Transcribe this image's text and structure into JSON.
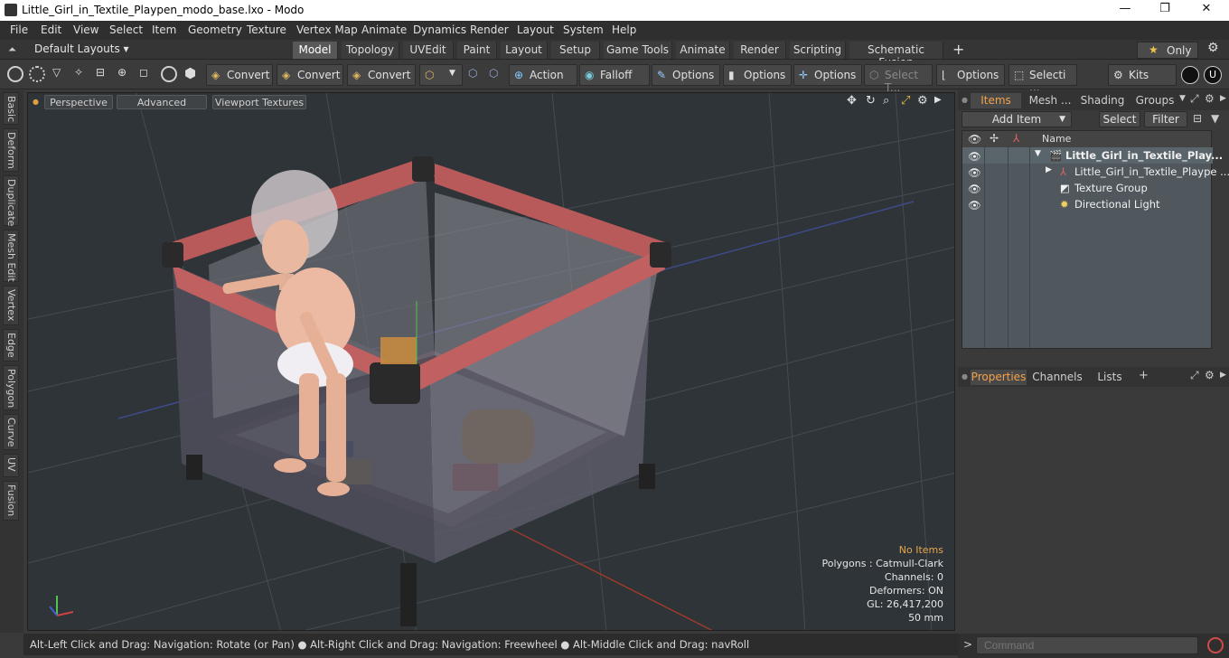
{
  "window": {
    "title": "Little_Girl_in_Textile_Playpen_modo_base.lxo - Modo",
    "minimize": "—",
    "maximize": "❐",
    "close": "✕"
  },
  "menu": [
    "File",
    "Edit",
    "View",
    "Select",
    "Item",
    "Geometry",
    "Texture",
    "Vertex Map",
    "Animate",
    "Dynamics",
    "Render",
    "Layout",
    "System",
    "Help"
  ],
  "layouts_dropdown": "Default Layouts ▾",
  "layout_tabs": [
    "Model",
    "Topology",
    "UVEdit",
    "Paint",
    "Layout",
    "Setup",
    "Game Tools",
    "Animate",
    "Render",
    "Scripting",
    "Schematic Fusion"
  ],
  "active_layout_tab": "Model",
  "add_tab": "+",
  "only_label": "Only",
  "toolbar": {
    "convert1": "Convert",
    "convert2": "Convert",
    "convert3": "Convert",
    "action": "Action",
    "falloff": "Falloff",
    "options1": "Options",
    "options2": "Options",
    "options3": "Options",
    "select_t": "Select T...",
    "options4": "Options",
    "selecti": "Selecti ...",
    "kits": "Kits"
  },
  "left_tabs": [
    "Basic",
    "Deform",
    "Duplicate",
    "Mesh Edit",
    "Vertex",
    "Edge",
    "Polygon",
    "Curve",
    "UV",
    "Fusion"
  ],
  "viewport": {
    "tabs": [
      "Perspective",
      "Advanced",
      "Viewport Textures"
    ],
    "info": {
      "no_items": "No Items",
      "polygons": "Polygons : Catmull-Clark",
      "channels": "Channels: 0",
      "deformers": "Deformers: ON",
      "gl": "GL: 26,417,200",
      "mm": "50 mm"
    }
  },
  "status_text": "Alt-Left Click and Drag: Navigation: Rotate (or Pan) ● Alt-Right Click and Drag: Navigation: Freewheel ● Alt-Middle Click and Drag: navRoll",
  "items_panel": {
    "tabs": [
      "Items",
      "Mesh ...",
      "Shading",
      "Groups"
    ],
    "add_item": "Add Item",
    "select": "Select",
    "filter": "Filter",
    "name_header": "Name",
    "rows": [
      {
        "name": "Little_Girl_in_Textile_Play..."
      },
      {
        "name": "Little_Girl_in_Textile_Plaype ..."
      },
      {
        "name": "Texture Group"
      },
      {
        "name": "Directional Light"
      }
    ]
  },
  "properties_panel": {
    "tabs": [
      "Properties",
      "Channels",
      "Lists"
    ],
    "add": "+"
  },
  "command": {
    "placeholder": "Command",
    "prompt": ">"
  },
  "colors": {
    "accent": "#f2a24a",
    "viewport_bg": "#2e3438",
    "rail_red": "#b85a5a",
    "fabric": "#4a4a58"
  }
}
